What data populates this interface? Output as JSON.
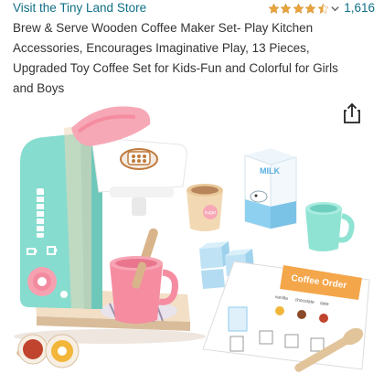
{
  "store": {
    "link_text": "Visit the Tiny Land Store"
  },
  "rating": {
    "stars": 4.5,
    "review_count": "1,616",
    "star_color": "#e8a33b"
  },
  "product": {
    "title": "Brew & Serve Wooden Coffee Maker Set- Play Kitchen Accessories, Encourages Imaginative Play, 13 Pieces, Upgraded Toy Coffee Set for Kids-Fun and Colorful for Girls and Boys"
  },
  "image": {
    "milk_carton_label": "MILK",
    "cup_label": "sugar",
    "order_card_title": "Coffee Order",
    "order_card_columns": [
      "vanilla",
      "chocolate",
      "latte"
    ]
  },
  "colors": {
    "link": "#0f6f86",
    "machine_teal": "#7fd9cf",
    "cup_pink": "#f48aa0",
    "pod_orange": "#f0a64a"
  },
  "icons": {
    "share": "share-icon",
    "chevron": "chevron-down-icon"
  }
}
